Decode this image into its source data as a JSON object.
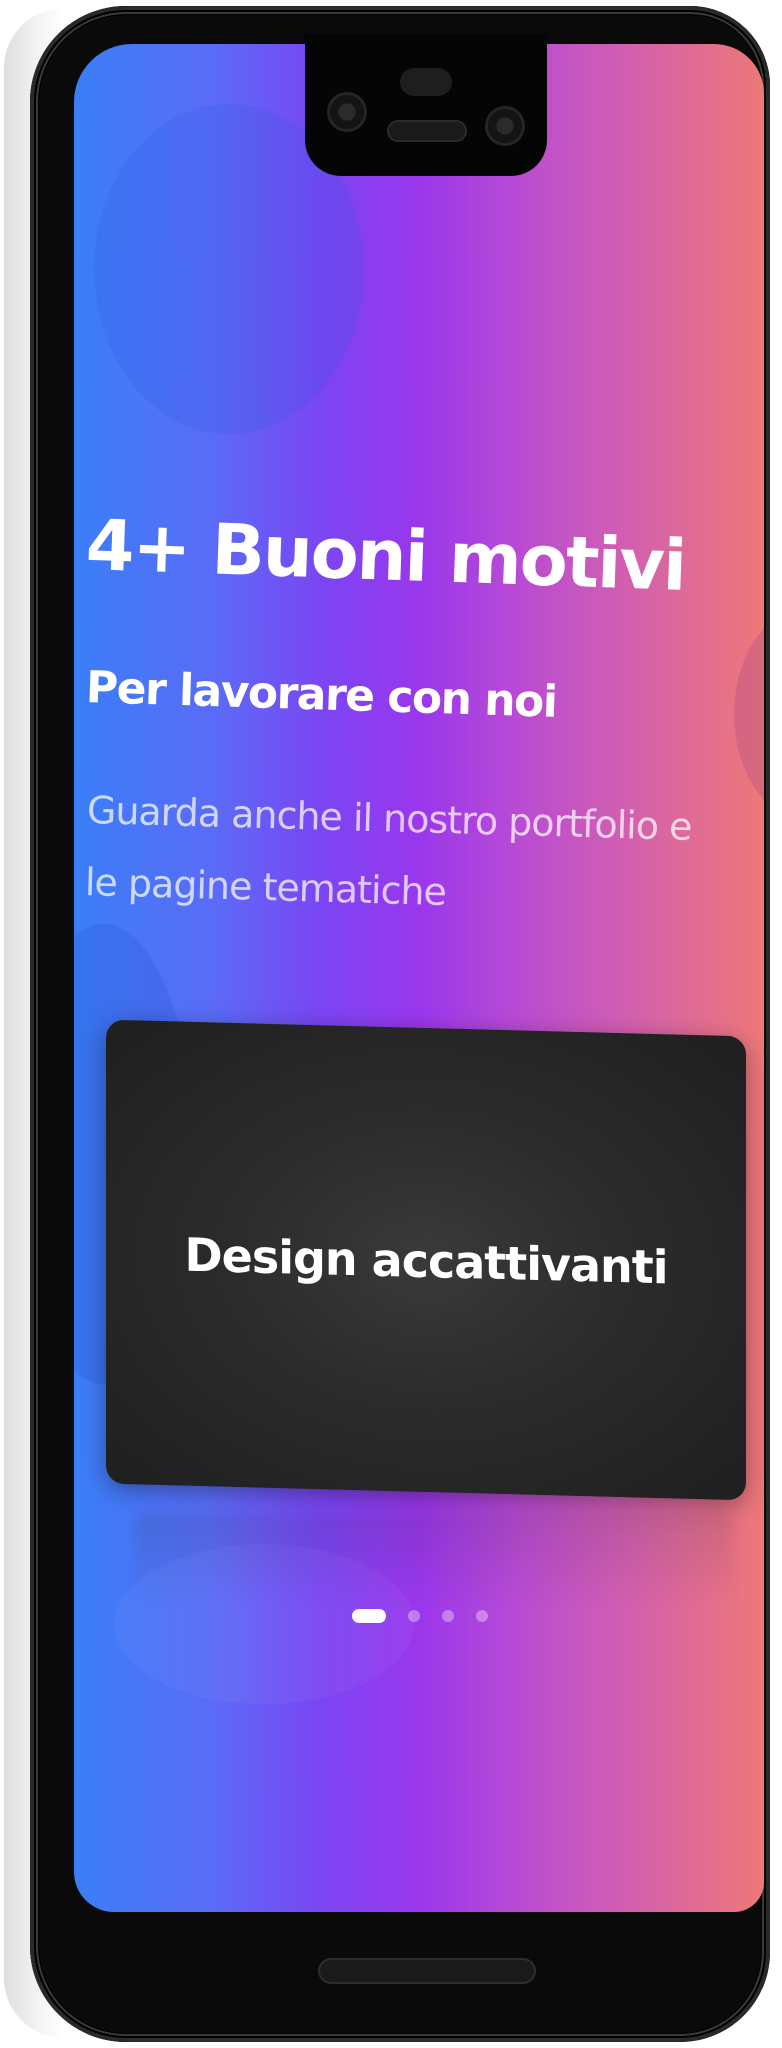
{
  "page": {
    "headline": "4+ Buoni motivi",
    "subtitle": "Per lavorare con noi",
    "description": "Guarda anche il nostro portfolio e le pagine tematiche"
  },
  "carousel": {
    "card_title": "Design accattivanti",
    "total_slides": 4,
    "active_slide": 1
  },
  "colors": {
    "gradient_start": "#3a7ef7",
    "gradient_mid": "#9a37ec",
    "gradient_end": "#ee7878",
    "card_background": "#2b2b2b",
    "text": "#ffffff"
  },
  "device": {
    "hardware": [
      "left-camera",
      "right-camera",
      "earpiece-speaker",
      "proximity-sensor",
      "home-indicator"
    ]
  }
}
